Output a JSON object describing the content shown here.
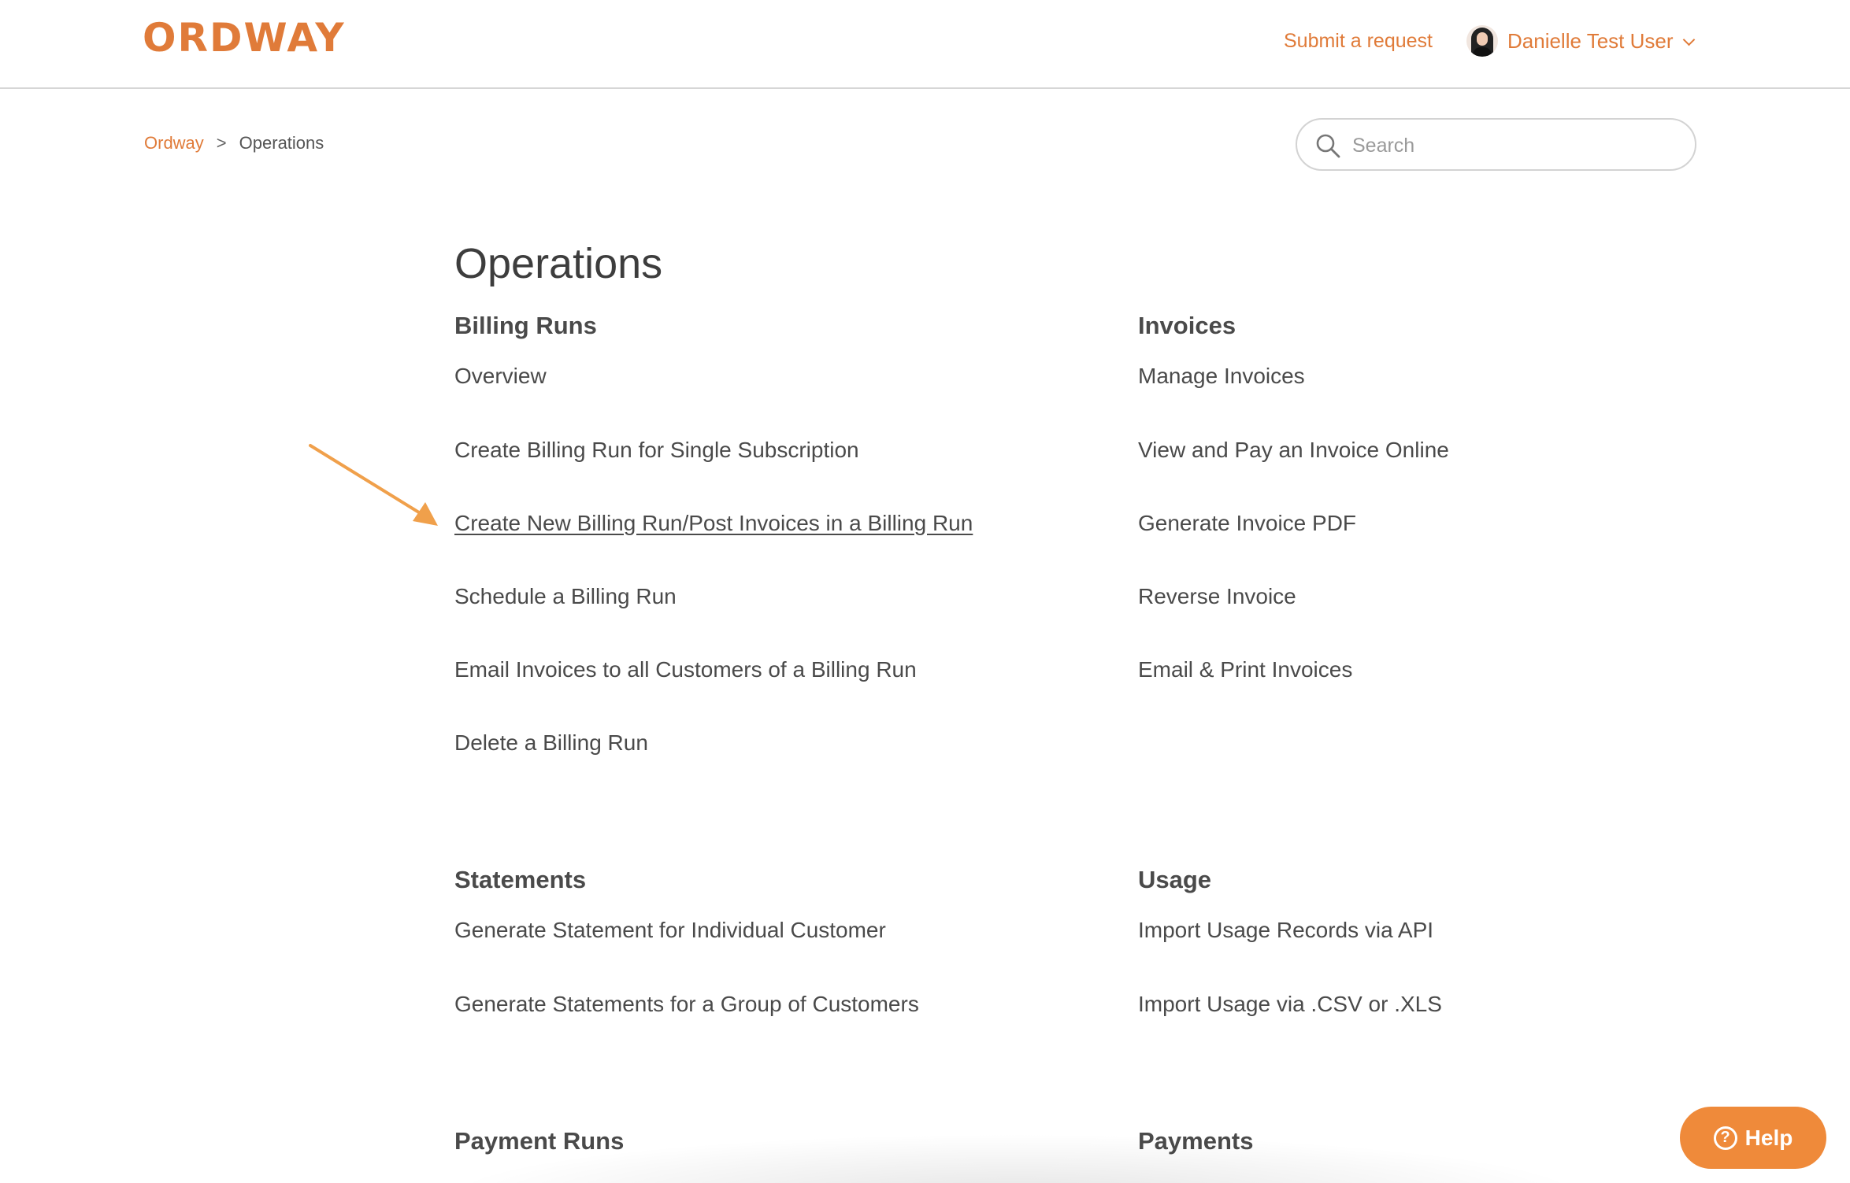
{
  "header": {
    "logo_text": "ORDWAY",
    "submit_request_label": "Submit a request",
    "user_name": "Danielle Test User"
  },
  "breadcrumb": {
    "items": [
      "Ordway",
      "Operations"
    ],
    "separator": ">"
  },
  "search": {
    "placeholder": "Search",
    "value": ""
  },
  "page": {
    "title": "Operations"
  },
  "sections": [
    {
      "title": "Billing Runs",
      "articles": [
        "Overview",
        "Create Billing Run for Single Subscription",
        "Create New Billing Run/Post Invoices in a Billing Run",
        "Schedule a Billing Run",
        "Email Invoices to all Customers of a Billing Run",
        "Delete a Billing Run"
      ]
    },
    {
      "title": "Invoices",
      "articles": [
        "Manage Invoices",
        "View and Pay an Invoice Online",
        "Generate Invoice PDF",
        "Reverse Invoice",
        "Email & Print Invoices"
      ]
    },
    {
      "title": "Statements",
      "articles": [
        "Generate Statement for Individual Customer",
        "Generate Statements for a Group of Customers"
      ]
    },
    {
      "title": "Usage",
      "articles": [
        "Import Usage Records via API",
        "Import Usage via .CSV or .XLS"
      ]
    },
    {
      "title": "Payment Runs",
      "articles": []
    },
    {
      "title": "Payments",
      "articles": []
    }
  ],
  "help_widget": {
    "label": "Help",
    "icon": "?"
  },
  "colors": {
    "brand": "#e07b39",
    "help_button": "#ef8a3a",
    "annotation_arrow": "#f0a04b",
    "text": "#4a4a4a"
  },
  "icons": {
    "search": "search-icon",
    "chevron": "chevron-down-icon",
    "help": "question-circle-icon",
    "annotation": "arrow-icon"
  }
}
